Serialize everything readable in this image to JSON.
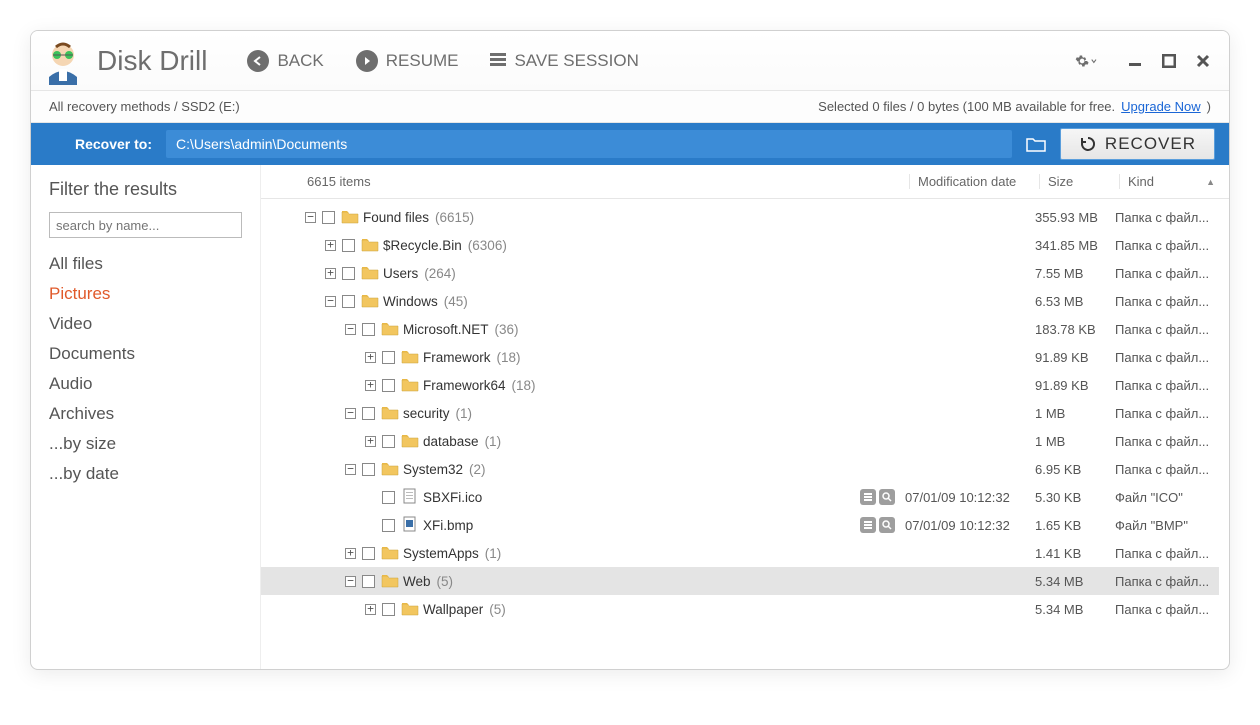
{
  "app_title": "Disk Drill",
  "top_actions": {
    "back": "BACK",
    "resume": "RESUME",
    "save_session": "SAVE SESSION"
  },
  "breadcrumb": "All recovery methods / SSD2 (E:)",
  "status_right": {
    "selected_text": "Selected 0 files / 0 bytes (100 MB available for free.",
    "upgrade": "Upgrade Now",
    "trail": ")"
  },
  "recover": {
    "label": "Recover to:",
    "path": "C:\\Users\\admin\\Documents",
    "button": "RECOVER"
  },
  "sidebar": {
    "title": "Filter the results",
    "search_placeholder": "search by name...",
    "filters": [
      "All files",
      "Pictures",
      "Video",
      "Documents",
      "Audio",
      "Archives",
      "...by size",
      "...by date"
    ],
    "active_filter_index": 1
  },
  "list_header": {
    "items_count": "6615 items",
    "date": "Modification date",
    "size": "Size",
    "kind": "Kind"
  },
  "tree": [
    {
      "depth": 0,
      "expand": "-",
      "icon": "folder",
      "name": "Found files",
      "count": "(6615)",
      "date": "",
      "size": "355.93 MB",
      "kind": "Папка с файл...",
      "sel": false
    },
    {
      "depth": 1,
      "expand": "+",
      "icon": "folder",
      "name": "$Recycle.Bin",
      "count": "(6306)",
      "date": "",
      "size": "341.85 MB",
      "kind": "Папка с файл...",
      "sel": false
    },
    {
      "depth": 1,
      "expand": "+",
      "icon": "folder",
      "name": "Users",
      "count": "(264)",
      "date": "",
      "size": "7.55 MB",
      "kind": "Папка с файл...",
      "sel": false
    },
    {
      "depth": 1,
      "expand": "-",
      "icon": "folder",
      "name": "Windows",
      "count": "(45)",
      "date": "",
      "size": "6.53 MB",
      "kind": "Папка с файл...",
      "sel": false
    },
    {
      "depth": 2,
      "expand": "-",
      "icon": "folder",
      "name": "Microsoft.NET",
      "count": "(36)",
      "date": "",
      "size": "183.78 KB",
      "kind": "Папка с файл...",
      "sel": false
    },
    {
      "depth": 3,
      "expand": "+",
      "icon": "folder",
      "name": "Framework",
      "count": "(18)",
      "date": "",
      "size": "91.89 KB",
      "kind": "Папка с файл...",
      "sel": false
    },
    {
      "depth": 3,
      "expand": "+",
      "icon": "folder",
      "name": "Framework64",
      "count": "(18)",
      "date": "",
      "size": "91.89 KB",
      "kind": "Папка с файл...",
      "sel": false
    },
    {
      "depth": 2,
      "expand": "-",
      "icon": "folder",
      "name": "security",
      "count": "(1)",
      "date": "",
      "size": "1 MB",
      "kind": "Папка с файл...",
      "sel": false
    },
    {
      "depth": 3,
      "expand": "+",
      "icon": "folder",
      "name": "database",
      "count": "(1)",
      "date": "",
      "size": "1 MB",
      "kind": "Папка с файл...",
      "sel": false
    },
    {
      "depth": 2,
      "expand": "-",
      "icon": "folder",
      "name": "System32",
      "count": "(2)",
      "date": "",
      "size": "6.95 KB",
      "kind": "Папка с файл...",
      "sel": false
    },
    {
      "depth": 3,
      "expand": "",
      "icon": "file-ico",
      "name": "SBXFi.ico",
      "count": "",
      "date": "07/01/09 10:12:32",
      "size": "5.30 KB",
      "kind": "Файл \"ICO\"",
      "sel": false,
      "extras": true
    },
    {
      "depth": 3,
      "expand": "",
      "icon": "file-bmp",
      "name": "XFi.bmp",
      "count": "",
      "date": "07/01/09 10:12:32",
      "size": "1.65 KB",
      "kind": "Файл \"BMP\"",
      "sel": false,
      "extras": true
    },
    {
      "depth": 2,
      "expand": "+",
      "icon": "folder",
      "name": "SystemApps",
      "count": "(1)",
      "date": "",
      "size": "1.41 KB",
      "kind": "Папка с файл...",
      "sel": false
    },
    {
      "depth": 2,
      "expand": "-",
      "icon": "folder",
      "name": "Web",
      "count": "(5)",
      "date": "",
      "size": "5.34 MB",
      "kind": "Папка с файл...",
      "sel": true
    },
    {
      "depth": 3,
      "expand": "+",
      "icon": "folder",
      "name": "Wallpaper",
      "count": "(5)",
      "date": "",
      "size": "5.34 MB",
      "kind": "Папка с файл...",
      "sel": false
    }
  ]
}
